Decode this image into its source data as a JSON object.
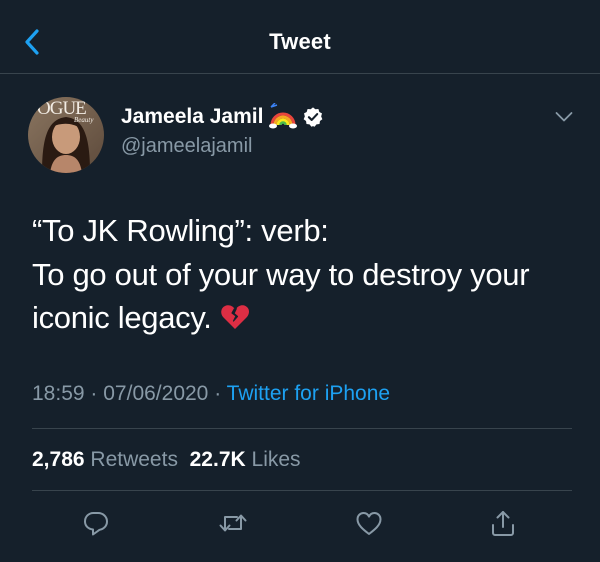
{
  "header": {
    "title": "Tweet",
    "back_icon": "chevron-left-icon"
  },
  "author": {
    "display_name": "Jameela Jamil",
    "handle": "@jameelajamil",
    "avatar_magazine_text": "OGUE",
    "avatar_sub_text": "Beauty",
    "name_emoji": "rainbow-icon",
    "verified_icon": "verified-badge-icon"
  },
  "tweet": {
    "lines": [
      "“To JK Rowling”: verb:",
      "To go out of your way to destroy your",
      "iconic legacy."
    ],
    "emoji": "broken-heart-icon"
  },
  "meta": {
    "time": "18:59",
    "separator": "·",
    "date": "07/06/2020",
    "source": "Twitter for iPhone"
  },
  "stats": {
    "retweets_count": "2,786",
    "retweets_label": "Retweets",
    "likes_count": "22.7K",
    "likes_label": "Likes"
  },
  "actions": [
    "reply-icon",
    "retweet-icon",
    "like-icon",
    "share-icon"
  ],
  "colors": {
    "background": "#15202b",
    "divider": "#38444d",
    "secondary_text": "#8899a6",
    "accent": "#1da1f2"
  }
}
